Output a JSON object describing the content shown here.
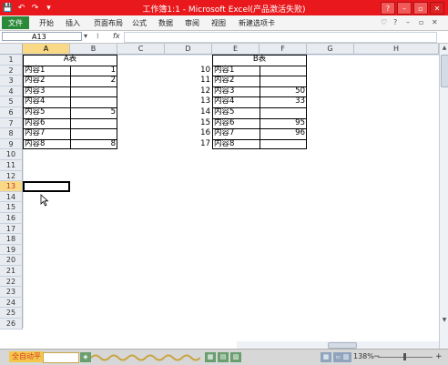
{
  "window": {
    "title": "工作簿1:1 - Microsoft Excel(产品激活失败)",
    "quick_access": [
      "💾",
      "↶",
      "↷",
      "▾"
    ],
    "controls": [
      "?",
      "–",
      "▫",
      "✕"
    ]
  },
  "ribbon": {
    "file_tab": "文件",
    "tabs": [
      "开始",
      "插入",
      "页面布局",
      "公式",
      "数据",
      "审阅",
      "视图",
      "新建选项卡"
    ],
    "right_controls": [
      "♡",
      "?",
      "–",
      "▫",
      "✕"
    ]
  },
  "formula_bar": {
    "name_box": "A13",
    "fx_label": "fx",
    "value": ""
  },
  "sheet": {
    "columns": [
      "A",
      "B",
      "C",
      "D",
      "E",
      "F",
      "G",
      "H"
    ],
    "rows": [
      "1",
      "2",
      "3",
      "4",
      "5",
      "6",
      "7",
      "8",
      "9",
      "10",
      "11",
      "12",
      "13",
      "14",
      "15",
      "16",
      "17",
      "18",
      "19",
      "20",
      "21",
      "22",
      "23",
      "24",
      "25",
      "26"
    ],
    "selected_column": "A",
    "selected_row": "13",
    "table_a": {
      "header": "A表",
      "names": [
        "内容1",
        "内容2",
        "内容3",
        "内容4",
        "内容5",
        "内容6",
        "内容7",
        "内容8"
      ],
      "values": [
        "1",
        "2",
        "",
        "",
        "5",
        "",
        "",
        "8"
      ]
    },
    "table_b": {
      "header": "B表",
      "index": [
        "10",
        "11",
        "12",
        "13",
        "14",
        "15",
        "16",
        "17"
      ],
      "names": [
        "内容1",
        "内容2",
        "内容3",
        "内容4",
        "内容5",
        "内容6",
        "内容7",
        "内容8"
      ],
      "values": [
        "",
        "",
        "50",
        "33",
        "",
        "95",
        "96",
        ""
      ]
    }
  },
  "status_bar": {
    "ready": "全自动平",
    "zoom": "138%",
    "minus": "−",
    "plus": "+"
  }
}
